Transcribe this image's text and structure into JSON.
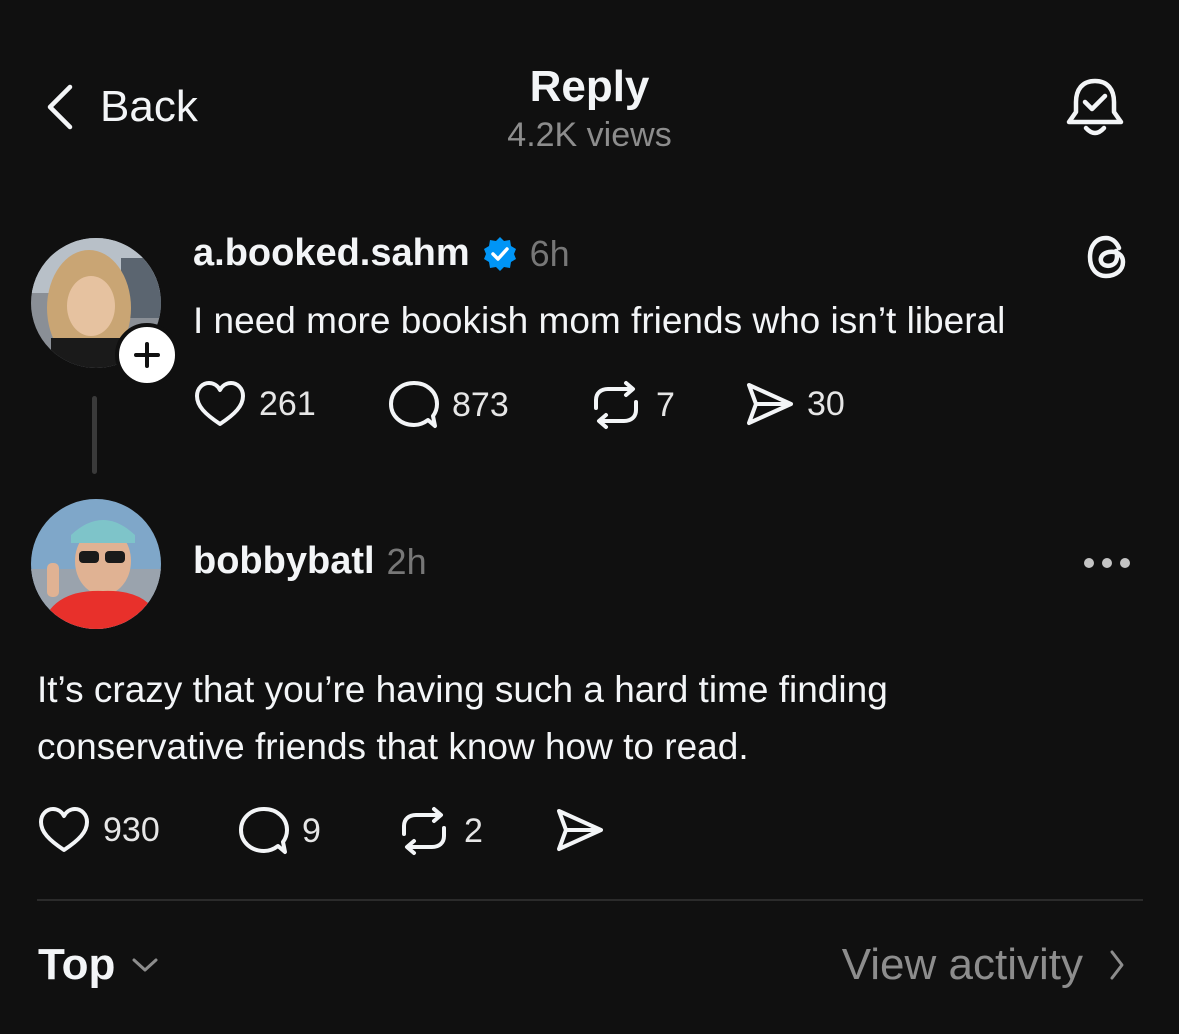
{
  "header": {
    "back_label": "Back",
    "title": "Reply",
    "views": "4.2K views"
  },
  "original_post": {
    "username": "a.booked.sahm",
    "verified": true,
    "time": "6h",
    "text": "I need more bookish mom friends who isn’t liberal",
    "likes": "261",
    "replies": "873",
    "reposts": "7",
    "shares": "30"
  },
  "reply_post": {
    "username": "bobbybatl",
    "time": "2h",
    "text_line1": "It’s crazy that you’re having such a hard time finding",
    "text_line2": "conservative friends that know how to read.",
    "likes": "930",
    "replies": "9",
    "reposts": "2"
  },
  "footer": {
    "sort_label": "Top",
    "view_activity_label": "View activity"
  },
  "colors": {
    "background": "#101010",
    "text": "#f3f5f7",
    "muted": "#8d8d8d",
    "verified_blue": "#0095f6"
  },
  "icons": [
    "chevron-left-icon",
    "bell-check-icon",
    "verified-badge-icon",
    "threads-logo-icon",
    "heart-icon",
    "comment-icon",
    "repost-icon",
    "share-icon",
    "more-icon",
    "chevron-down-icon",
    "chevron-right-icon",
    "plus-icon"
  ]
}
